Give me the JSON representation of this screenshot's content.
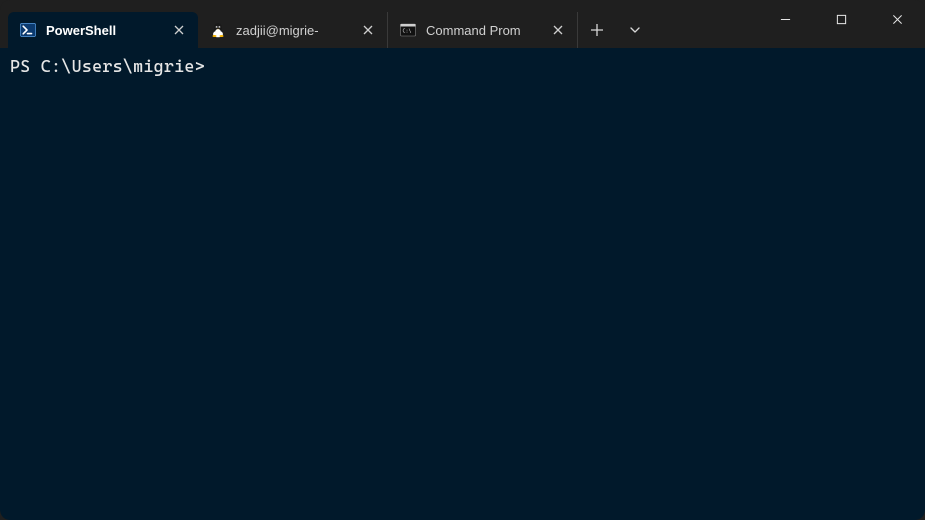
{
  "tabs": [
    {
      "label": "PowerShell",
      "icon": "powershell-icon",
      "active": true
    },
    {
      "label": "zadjii@migrie-",
      "icon": "tux-icon",
      "active": false
    },
    {
      "label": "Command Prom",
      "icon": "cmd-icon",
      "active": false
    }
  ],
  "terminal": {
    "prompt": "PS C:\\Users\\migrie>"
  },
  "colors": {
    "terminal_bg": "#01192b",
    "titlebar_bg": "#1f1f1f",
    "text": "#e6e6e6"
  }
}
